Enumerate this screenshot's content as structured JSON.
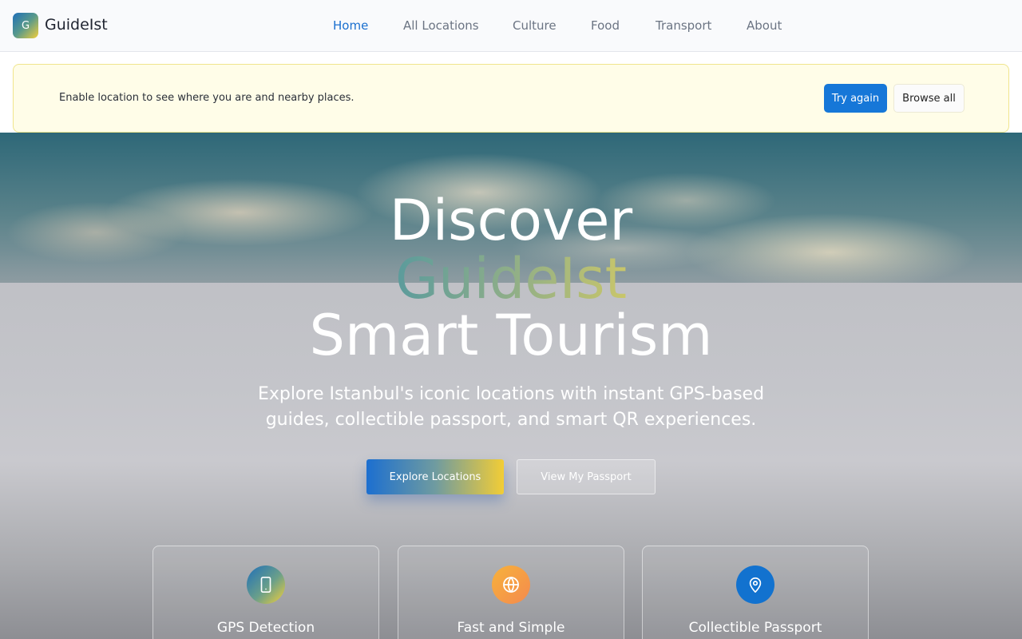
{
  "header": {
    "logo_letter": "G",
    "brand": "GuideIst",
    "nav": [
      {
        "label": "Home",
        "active": true
      },
      {
        "label": "All Locations",
        "active": false
      },
      {
        "label": "Culture",
        "active": false
      },
      {
        "label": "Food",
        "active": false
      },
      {
        "label": "Transport",
        "active": false
      },
      {
        "label": "About",
        "active": false
      }
    ]
  },
  "alert": {
    "message": "Enable location to see where you are and nearby places.",
    "try_again": "Try again",
    "browse_all": "Browse all"
  },
  "hero": {
    "line1": "Discover",
    "line2": "GuideIst",
    "line3": "Smart Tourism",
    "subtitle": "Explore Istanbul's iconic locations with instant GPS-based guides, collectible passport, and smart QR experiences.",
    "explore_button": "Explore Locations",
    "passport_button": "View My Passport"
  },
  "features": [
    {
      "title": "GPS Detection",
      "icon": "phone-icon"
    },
    {
      "title": "Fast and Simple",
      "icon": "globe-icon"
    },
    {
      "title": "Collectible Passport",
      "icon": "map-pin-icon"
    }
  ],
  "colors": {
    "accent": "#1677d8",
    "nav_active": "#1a6fcf",
    "alert_bg": "#fffde8"
  }
}
